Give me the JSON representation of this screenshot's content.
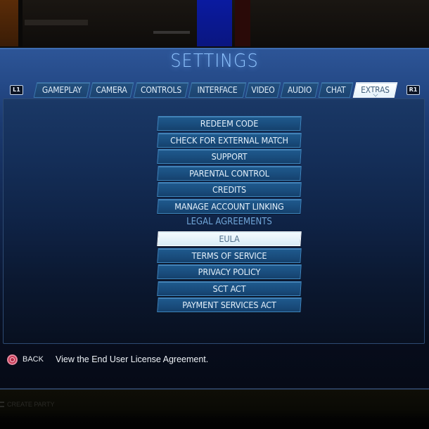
{
  "title": "SETTINGS",
  "shoulder_left": "L1",
  "shoulder_right": "R1",
  "tabs": [
    {
      "label": "GAMEPLAY",
      "active": false
    },
    {
      "label": "CAMERA",
      "active": false
    },
    {
      "label": "CONTROLS",
      "active": false
    },
    {
      "label": "INTERFACE",
      "active": false
    },
    {
      "label": "VIDEO",
      "active": false
    },
    {
      "label": "AUDIO",
      "active": false
    },
    {
      "label": "CHAT",
      "active": false
    },
    {
      "label": "EXTRAS",
      "active": true
    }
  ],
  "menu": {
    "items": [
      {
        "label": "REDEEM CODE"
      },
      {
        "label": "CHECK FOR EXTERNAL MATCH"
      },
      {
        "label": "SUPPORT"
      },
      {
        "label": "PARENTAL CONTROL"
      },
      {
        "label": "CREDITS"
      },
      {
        "label": "MANAGE ACCOUNT LINKING"
      }
    ],
    "legal_heading": "LEGAL AGREEMENTS",
    "legal_items": [
      {
        "label": "EULA",
        "selected": true
      },
      {
        "label": "TERMS OF SERVICE",
        "selected": false
      },
      {
        "label": "PRIVACY POLICY",
        "selected": false
      },
      {
        "label": "SCT ACT",
        "selected": false
      },
      {
        "label": "PAYMENT SERVICES ACT",
        "selected": false
      }
    ]
  },
  "footer": {
    "back_icon": "circle-button-icon",
    "back_label": "BACK",
    "help_text": "View the End User License Agreement."
  },
  "background": {
    "party_label": "CREATE PARTY"
  },
  "colors": {
    "accent": "#8fc4ff",
    "selected_bg": "#f4fbff",
    "button_bg": "#1f5a8e",
    "back_icon": "#c73a56"
  }
}
